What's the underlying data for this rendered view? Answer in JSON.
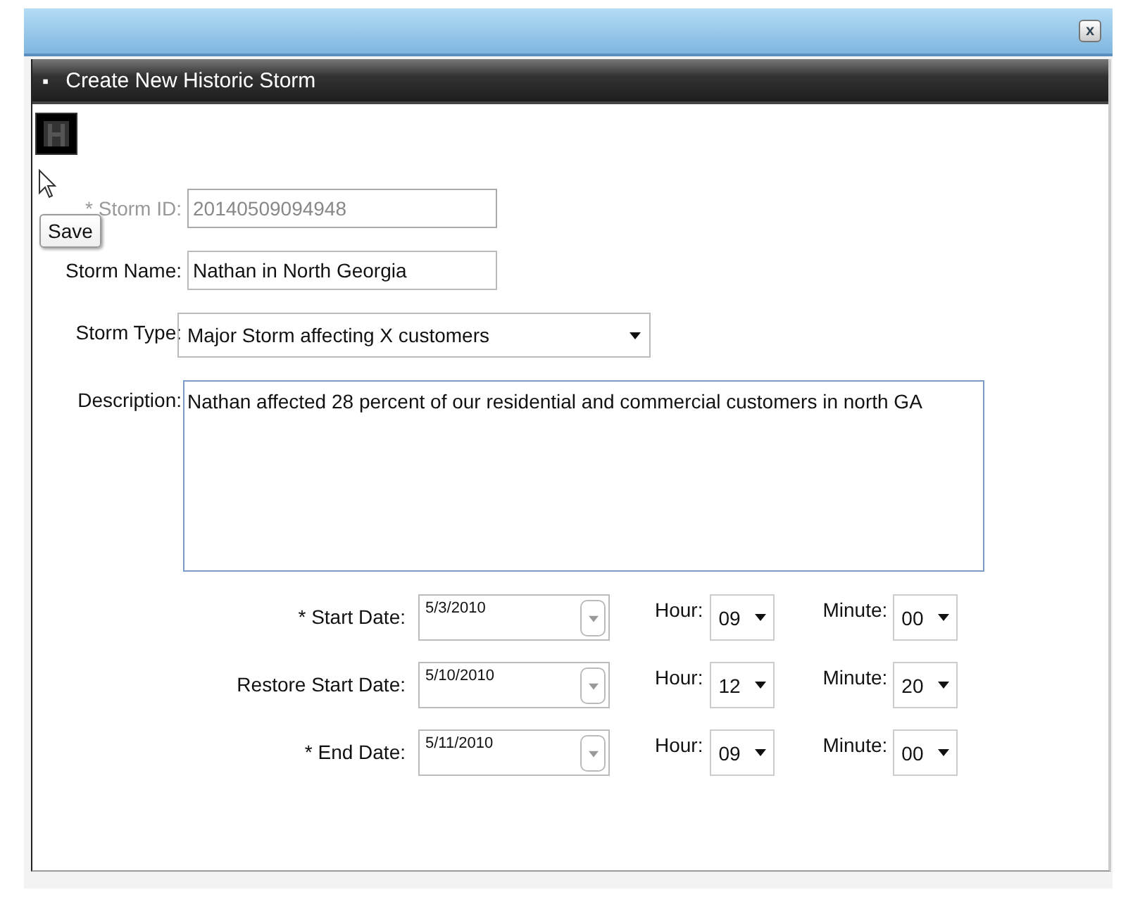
{
  "dialog": {
    "close_label": "x"
  },
  "panel": {
    "title": "Create New Historic Storm",
    "collapse_label": "▪"
  },
  "toolbar": {
    "save_tooltip": "Save"
  },
  "fields": [
    {
      "kind": "text",
      "label": "* Storm ID:",
      "value": "20140509094948",
      "disabled": true
    },
    {
      "kind": "text",
      "label": "Storm Name:",
      "value": "Nathan in North Georgia",
      "disabled": false
    },
    {
      "kind": "select",
      "label": "Storm Type:",
      "value": "Major Storm affecting X customers"
    },
    {
      "kind": "textarea",
      "label": "Description:",
      "value": "Nathan affected 28 percent of our residential and commercial customers in north GA"
    }
  ],
  "dates": [
    {
      "label": "* Start Date:",
      "date": "5/3/2010",
      "hour_label": "Hour:",
      "hour": "09",
      "minute_label": "Minute:",
      "minute": "00"
    },
    {
      "label": "Restore Start Date:",
      "date": "5/10/2010",
      "hour_label": "Hour:",
      "hour": "12",
      "minute_label": "Minute:",
      "minute": "20"
    },
    {
      "label": "* End Date:",
      "date": "5/11/2010",
      "hour_label": "Hour:",
      "hour": "09",
      "minute_label": "Minute:",
      "minute": "00"
    }
  ]
}
